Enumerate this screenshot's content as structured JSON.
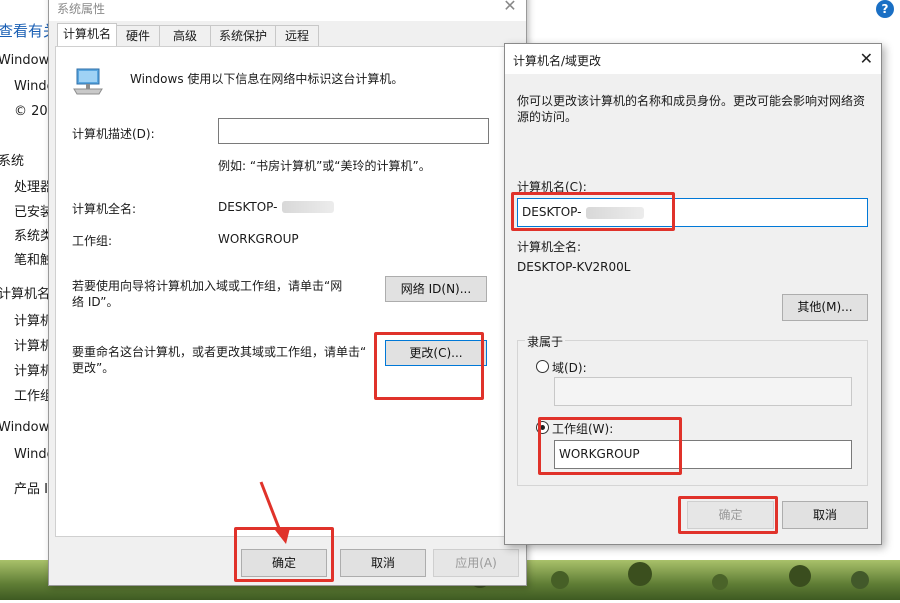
{
  "background": {
    "title": "查看有关",
    "items": [
      "Windows",
      "Windo",
      "© 20",
      "系统",
      "处理器",
      "已安装",
      "系统类",
      "笔和触",
      "计算机名、",
      "计算机",
      "计算机",
      "计算机",
      "工作组",
      "Windows",
      "Windo",
      "产品 I"
    ],
    "help_icon": "?"
  },
  "system_properties": {
    "title": "系统属性",
    "close": "✕",
    "tabs": [
      "计算机名",
      "硬件",
      "高级",
      "系统保护",
      "远程"
    ],
    "intro": "Windows 使用以下信息在网络中标识这台计算机。",
    "description_label": "计算机描述(D):",
    "description_value": "",
    "example": "例如: “书房计算机”或“美玲的计算机”。",
    "full_name_label": "计算机全名:",
    "full_name_value": "DESKTOP-",
    "workgroup_label": "工作组:",
    "workgroup_value": "WORKGROUP",
    "network_text_1": "若要使用向导将计算机加入域或工作组，请单击“网",
    "network_text_2": "络 ID”。",
    "network_id_button": "网络 ID(N)...",
    "rename_text_1": "要重命名这台计算机，或者更改其域或工作组，请单击“",
    "rename_text_2": "更改”。",
    "change_button": "更改(C)...",
    "ok_button": "确定",
    "cancel_button": "取消",
    "apply_button": "应用(A)"
  },
  "name_dialog": {
    "title": "计算机名/域更改",
    "close": "✕",
    "desc_1": "你可以更改该计算机的名称和成员身份。更改可能会影响对网络资",
    "desc_2": "源的访问。",
    "computer_name_label": "计算机名(C):",
    "computer_name_value": "DESKTOP-",
    "full_name_label": "计算机全名:",
    "full_name_value": "DESKTOP-KV2R00L",
    "more_button": "其他(M)...",
    "member_of_label": "隶属于",
    "domain_label": "域(D):",
    "domain_value": "",
    "workgroup_label": "工作组(W):",
    "workgroup_value": "WORKGROUP",
    "selected": "workgroup",
    "ok_button": "确定",
    "cancel_button": "取消"
  },
  "colors": {
    "highlight": "#e0322a",
    "accent": "#0078d7"
  }
}
